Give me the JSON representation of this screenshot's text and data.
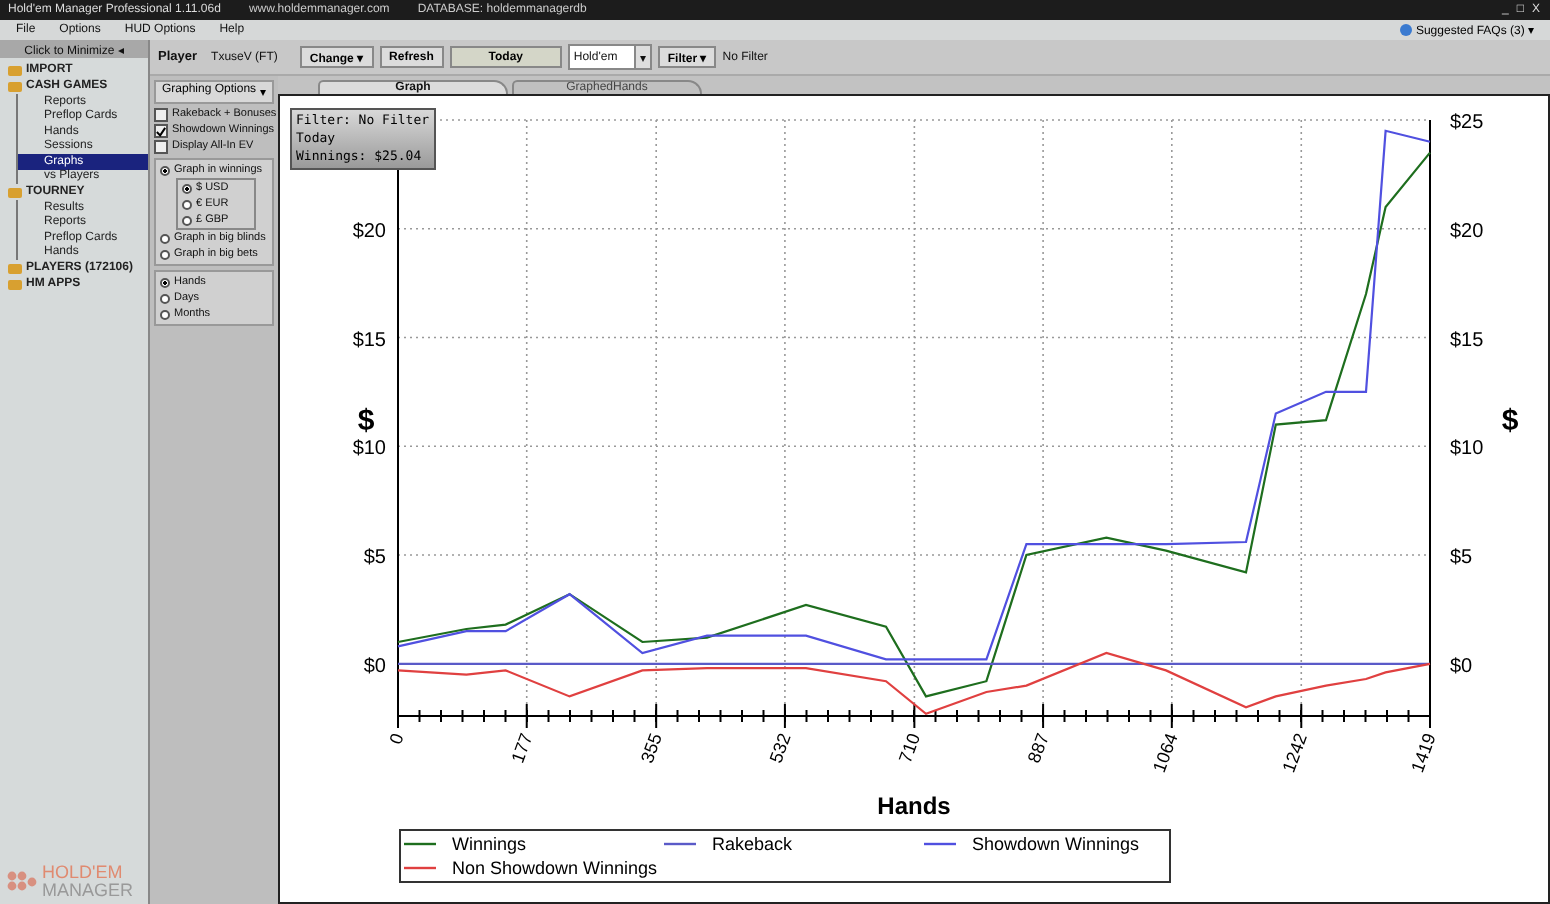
{
  "window": {
    "title": "Hold'em Manager Professional 1.11.06d",
    "site": "www.holdemmanager.com",
    "database": "DATABASE: holdemmanagerdb",
    "controls": [
      "_",
      "□",
      "X"
    ]
  },
  "menu": [
    "File",
    "Options",
    "HUD Options",
    "Help"
  ],
  "faq": {
    "label": "Suggested FAQs (3)",
    "caret": "▾"
  },
  "sidebar": {
    "minimize": "Click to Minimize",
    "minimize_icon": "◂",
    "items": [
      {
        "label": "IMPORT",
        "selected": false
      },
      {
        "label": "CASH GAMES",
        "selected": false,
        "children": [
          {
            "label": "Reports",
            "selected": false
          },
          {
            "label": "Preflop Cards",
            "selected": false
          },
          {
            "label": "Hands",
            "selected": false
          },
          {
            "label": "Sessions",
            "selected": false
          },
          {
            "label": "Graphs",
            "selected": true
          },
          {
            "label": "vs Players",
            "selected": false
          }
        ]
      },
      {
        "label": "TOURNEY",
        "selected": false,
        "children": [
          {
            "label": "Results",
            "selected": false
          },
          {
            "label": "Reports",
            "selected": false
          },
          {
            "label": "Preflop Cards",
            "selected": false
          },
          {
            "label": "Hands",
            "selected": false
          }
        ]
      },
      {
        "label": "PLAYERS (172106)",
        "selected": false
      },
      {
        "label": "HM APPS",
        "selected": false
      }
    ],
    "logo": [
      "HOLD'EM",
      "MANAGER"
    ]
  },
  "toolbar": {
    "player_label": "Player",
    "player": "TxuseV (FT)",
    "change": "Change",
    "change_caret": "▾",
    "refresh": "Refresh",
    "today": "Today",
    "game": "Hold'em",
    "game_caret": "▾",
    "filter": "Filter",
    "filter_caret": "▾",
    "filter_value": "No Filter"
  },
  "options": {
    "title": "Graphing Options",
    "pin": "▾",
    "checks": [
      {
        "label": "Rakeback + Bonuses",
        "checked": false
      },
      {
        "label": "Showdown Winnings",
        "checked": true
      },
      {
        "label": "Display All-In EV",
        "checked": false
      }
    ],
    "units": [
      {
        "label": "Graph in winnings",
        "selected": true,
        "currencies": [
          {
            "label": "$ USD",
            "selected": true
          },
          {
            "label": "€ EUR",
            "selected": false
          },
          {
            "label": "£ GBP",
            "selected": false
          }
        ]
      },
      {
        "label": "Graph in big blinds",
        "selected": false
      },
      {
        "label": "Graph in big bets",
        "selected": false
      }
    ],
    "axis": [
      {
        "label": "Hands",
        "selected": true
      },
      {
        "label": "Days",
        "selected": false
      },
      {
        "label": "Months",
        "selected": false
      }
    ]
  },
  "tabs": [
    {
      "label": "Graph",
      "selected": true
    },
    {
      "label": "GraphedHands",
      "selected": false
    }
  ],
  "graph": {
    "summary": [
      "Filter: No Filter",
      "Today",
      "Winnings: $25.04"
    ],
    "right_ylabel": "$",
    "right_yticks": [
      "$25",
      "$20",
      "$15",
      "$10",
      "$5",
      "$0"
    ],
    "chart_data": {
      "type": "line",
      "xlabel": "Hands",
      "ylabel": "$",
      "xlim": [
        0,
        1419
      ],
      "ylim": [
        -2.4,
        25
      ],
      "grid": true,
      "legend": "bottom",
      "xticks": [
        0,
        177,
        355,
        532,
        710,
        887,
        1064,
        1242,
        1419
      ],
      "yticks": [
        {
          "value": 0,
          "label": "$0"
        },
        {
          "value": 5,
          "label": "$5"
        },
        {
          "value": 10,
          "label": "$10"
        },
        {
          "value": 15,
          "label": "$15"
        },
        {
          "value": 20,
          "label": "$20"
        }
      ],
      "x": [
        0,
        94,
        148,
        236,
        336,
        425,
        561,
        671,
        726,
        809,
        864,
        974,
        1056,
        1166,
        1207,
        1276,
        1331,
        1358,
        1419
      ],
      "series": [
        {
          "name": "Winnings",
          "color": "#1e6e1e",
          "values": [
            1.0,
            1.6,
            1.8,
            3.2,
            1.0,
            1.2,
            2.7,
            1.7,
            -1.5,
            -0.8,
            5.0,
            5.8,
            5.2,
            4.2,
            11.0,
            11.2,
            17.0,
            21.0,
            23.5
          ]
        },
        {
          "name": "Rakeback",
          "color": "#5a5ac8",
          "values": [
            0,
            0,
            0,
            0,
            0,
            0,
            0,
            0,
            0,
            0,
            0,
            0,
            0,
            0,
            0,
            0,
            0,
            0,
            0
          ]
        },
        {
          "name": "Showdown Winnings",
          "color": "#5050e0",
          "values": [
            0.8,
            1.5,
            1.5,
            3.2,
            0.5,
            1.3,
            1.3,
            0.2,
            0.2,
            0.2,
            5.5,
            5.5,
            5.5,
            5.6,
            11.5,
            12.5,
            12.5,
            24.5,
            24.0
          ]
        },
        {
          "name": "Non Showdown Winnings",
          "color": "#e04040",
          "values": [
            -0.3,
            -0.5,
            -0.3,
            -1.5,
            -0.3,
            -0.2,
            -0.2,
            -0.8,
            -2.3,
            -1.3,
            -1.0,
            0.5,
            -0.3,
            -2.0,
            -1.5,
            -1.0,
            -0.7,
            -0.4,
            0
          ]
        }
      ]
    }
  }
}
